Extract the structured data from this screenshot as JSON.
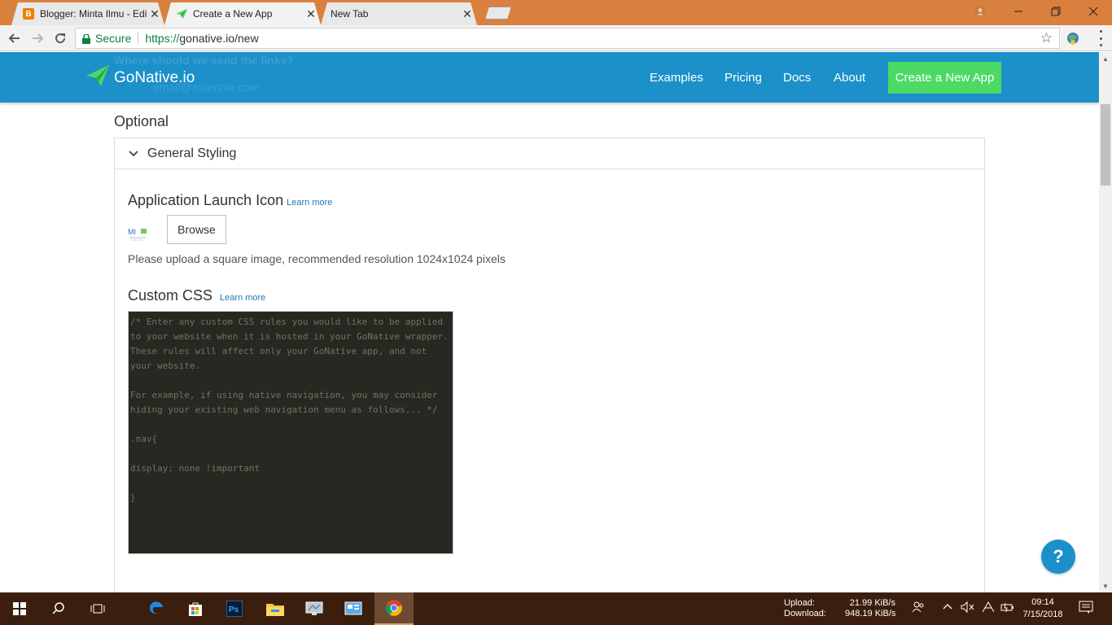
{
  "browser": {
    "tabs": [
      {
        "title": "Blogger: Minta Ilmu - Edi",
        "active": false
      },
      {
        "title": "Create a New App",
        "active": true
      },
      {
        "title": "New Tab",
        "active": false
      }
    ],
    "secure_label": "Secure",
    "url_scheme": "https://",
    "url_rest": "gonative.io/new"
  },
  "site": {
    "ghost_heading": "Where should we send the links?",
    "ghost_sub": "email@example.com",
    "logo_text": "GoNative.io",
    "nav": [
      "Examples",
      "Pricing",
      "Docs",
      "About"
    ],
    "cta": "Create a New App"
  },
  "content": {
    "optional_label": "Optional",
    "panel_title": "General Styling",
    "launch_icon_heading": "Application Launch Icon",
    "learn_more": "Learn more",
    "browse_label": "Browse",
    "upload_hint": "Please upload a square image, recommended resolution 1024x1024 pixels",
    "custom_css_heading": "Custom CSS",
    "css_placeholder": "/* Enter any custom CSS rules you would like to be applied\nto your website when it is hosted in your GoNative wrapper.\nThese rules will affect only your GoNative app, and not\nyour website.\n\nFor example, if using native navigation, you may consider\nhiding your existing web navigation menu as follows... */\n\n.nav{\n\ndisplay: none !important\n\n}",
    "help_label": "?"
  },
  "taskbar": {
    "upload_label": "Upload:",
    "download_label": "Download:",
    "upload_value": "21.99 KiB/s",
    "download_value": "948.19 KiB/s",
    "time": "09:14",
    "date": "7/15/2018"
  },
  "colors": {
    "header_blue": "#1b90c9",
    "cta_green": "#4cd964",
    "title_bar": "#d9803e",
    "taskbar": "#3b1e0e"
  }
}
